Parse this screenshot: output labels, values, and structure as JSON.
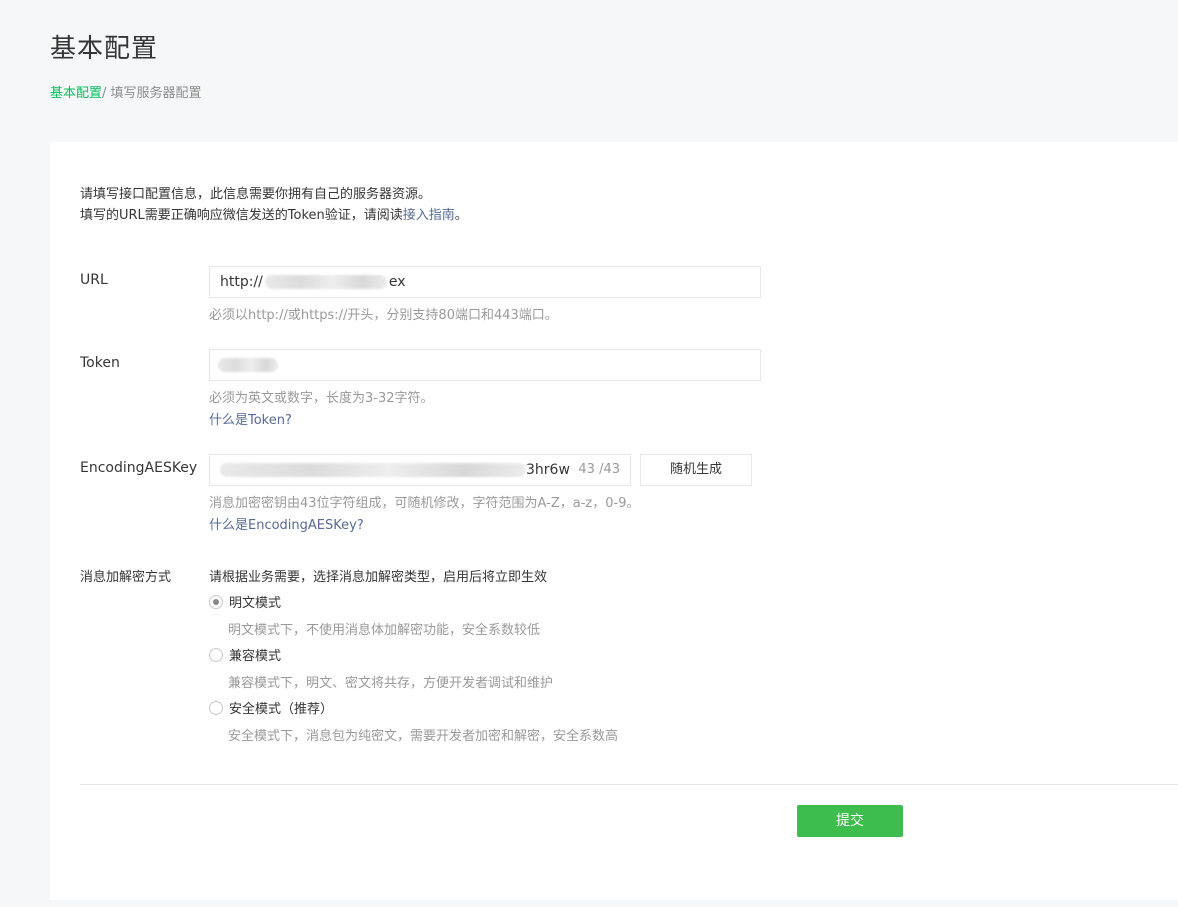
{
  "page": {
    "title": "基本配置"
  },
  "breadcrumb": {
    "link": "基本配置",
    "separator": "/ ",
    "current": "填写服务器配置"
  },
  "intro": {
    "line1": "请填写接口配置信息，此信息需要你拥有自己的服务器资源。",
    "line2_prefix": "填写的URL需要正确响应微信发送的Token验证，请阅读",
    "line2_link": "接入指南",
    "line2_suffix": "。"
  },
  "url": {
    "label": "URL",
    "value_prefix": "http://",
    "value_suffix": "ex",
    "hint": "必须以http://或https://开头，分别支持80端口和443端口。"
  },
  "token": {
    "label": "Token",
    "hint": "必须为英文或数字，长度为3-32字符。",
    "help_link": "什么是Token?"
  },
  "aes": {
    "label": "EncodingAESKey",
    "value_suffix": "3hr6w",
    "count": "43 /43",
    "generate_button": "随机生成",
    "hint": "消息加密密钥由43位字符组成，可随机修改，字符范围为A-Z，a-z，0-9。",
    "help_link": "什么是EncodingAESKey?"
  },
  "encryption": {
    "label": "消息加解密方式",
    "description": "请根据业务需要，选择消息加解密类型，启用后将立即生效",
    "options": [
      {
        "label": "明文模式",
        "description": "明文模式下，不使用消息体加解密功能，安全系数较低",
        "checked": true
      },
      {
        "label": "兼容模式",
        "description": "兼容模式下，明文、密文将共存，方便开发者调试和维护",
        "checked": false
      },
      {
        "label": "安全模式（推荐）",
        "description": "安全模式下，消息包为纯密文，需要开发者加密和解密，安全系数高",
        "checked": false
      }
    ]
  },
  "submit_label": "提交",
  "colors": {
    "accent_green": "#07c160",
    "submit_green": "#3dbd4d",
    "link_blue": "#576b95"
  }
}
